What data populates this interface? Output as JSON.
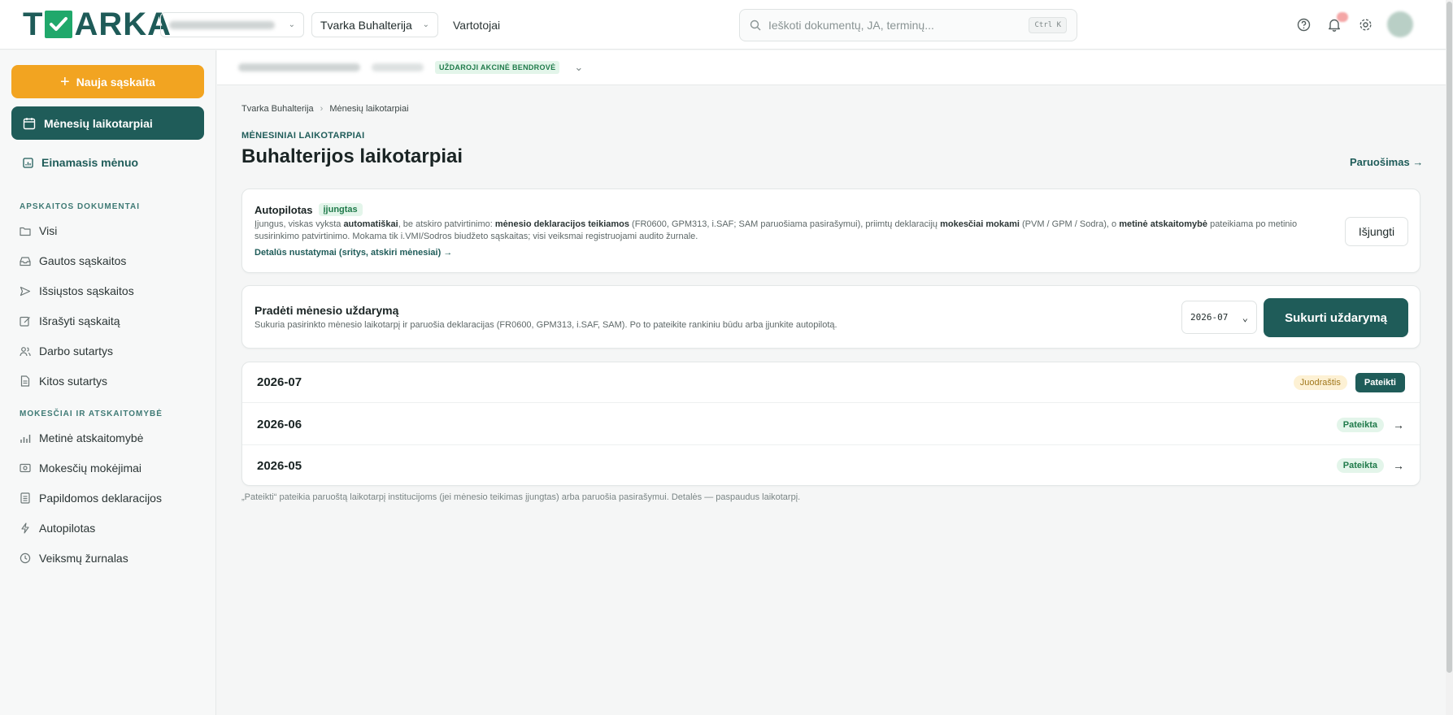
{
  "topbar": {
    "logo_left": "T",
    "logo_right": "ARKA",
    "app_select": "Tvarka Buhalterija",
    "nav_users": "Vartotojai",
    "search_placeholder": "Ieškoti dokumentų, JA, terminų...",
    "search_shortcut": "Ctrl K"
  },
  "sidebar": {
    "new_invoice": "Nauja sąskaita",
    "active_item": "Mėnesių laikotarpiai",
    "current_month": "Einamasis mėnuo",
    "section_docs": "APSKAITOS DOKUMENTAI",
    "docs_items": [
      {
        "label": "Visi",
        "icon": "folder-icon"
      },
      {
        "label": "Gautos sąskaitos",
        "icon": "inbox-icon"
      },
      {
        "label": "Išsiųstos sąskaitos",
        "icon": "send-icon"
      },
      {
        "label": "Išrašyti sąskaitą",
        "icon": "edit-icon"
      },
      {
        "label": "Darbo sutartys",
        "icon": "users-icon"
      },
      {
        "label": "Kitos sutartys",
        "icon": "file-icon"
      }
    ],
    "section_tax": "MOKESČIAI IR ATSKAITOMYBĖ",
    "tax_items": [
      {
        "label": "Metinė atskaitomybė",
        "icon": "bar-chart-icon"
      },
      {
        "label": "Mokesčių mokėjimai",
        "icon": "money-icon"
      },
      {
        "label": "Papildomos deklaracijos",
        "icon": "list-icon"
      },
      {
        "label": "Autopilotas",
        "icon": "lightning-icon"
      },
      {
        "label": "Veiksmų žurnalas",
        "icon": "clock-icon"
      }
    ]
  },
  "org_bar": {
    "badge": "UŽDAROJI AKCINĖ BENDROVĖ"
  },
  "breadcrumb": {
    "root": "Tvarka Buhalterija",
    "current": "Mėnesių laikotarpiai"
  },
  "header": {
    "kicker": "MĖNESINIAI LAIKOTARPIAI",
    "title": "Buhalterijos laikotarpiai",
    "prep_link": "Paruošimas →"
  },
  "autopilot": {
    "title": "Autopilotas",
    "status": "įjungtas",
    "desc_1": "Įjungus, viskas vyksta ",
    "desc_2": "automatiškai",
    "desc_3": ", be atskiro patvirtinimo: ",
    "desc_4": "mėnesio deklaracijos teikiamos",
    "desc_5": " (FR0600, GPM313, i.SAF; SAM paruošiama pasirašymui), priimtų deklaracijų ",
    "desc_6": "mokesčiai mokami",
    "desc_7": " (PVM / GPM / Sodra), o ",
    "desc_8": "metinė atskaitomybė",
    "desc_9": " pateikiama po metinio susirinkimo patvirtinimo. Mokama tik i.VMI/Sodros biudžeto sąskaitas; visi veiksmai registruojami audito žurnale.",
    "link": "Detalūs nustatymai (sritys, atskiri mėnesiai) →",
    "disable_button": "Išjungti"
  },
  "close_month": {
    "title": "Pradėti mėnesio uždarymą",
    "desc": "Sukuria pasirinkto mėnesio laikotarpį ir paruošia deklaracijas (FR0600, GPM313, i.SAF, SAM). Po to pateikite rankiniu būdu arba įjunkite autopilotą.",
    "period_value": "2026-07",
    "create_button": "Sukurti uždarymą"
  },
  "periods": [
    {
      "period": "2026-07",
      "draft": "Juodraštis",
      "action": "Pateikti"
    },
    {
      "period": "2026-06",
      "status": "Pateikta",
      "arrow": "→"
    },
    {
      "period": "2026-05",
      "status": "Pateikta",
      "arrow": "→"
    }
  ],
  "footnote": "„Pateikti“ pateikia paruoštą laikotarpį institucijoms (jei mėnesio teikimas įjungtas) arba paruošia pasirašymui. Detalės — paspaudus laikotarpį.",
  "colors": {
    "brand": "#1f5c59",
    "accent": "#f2a421",
    "success": "#1f7a4a",
    "draft": "#a0771b"
  }
}
